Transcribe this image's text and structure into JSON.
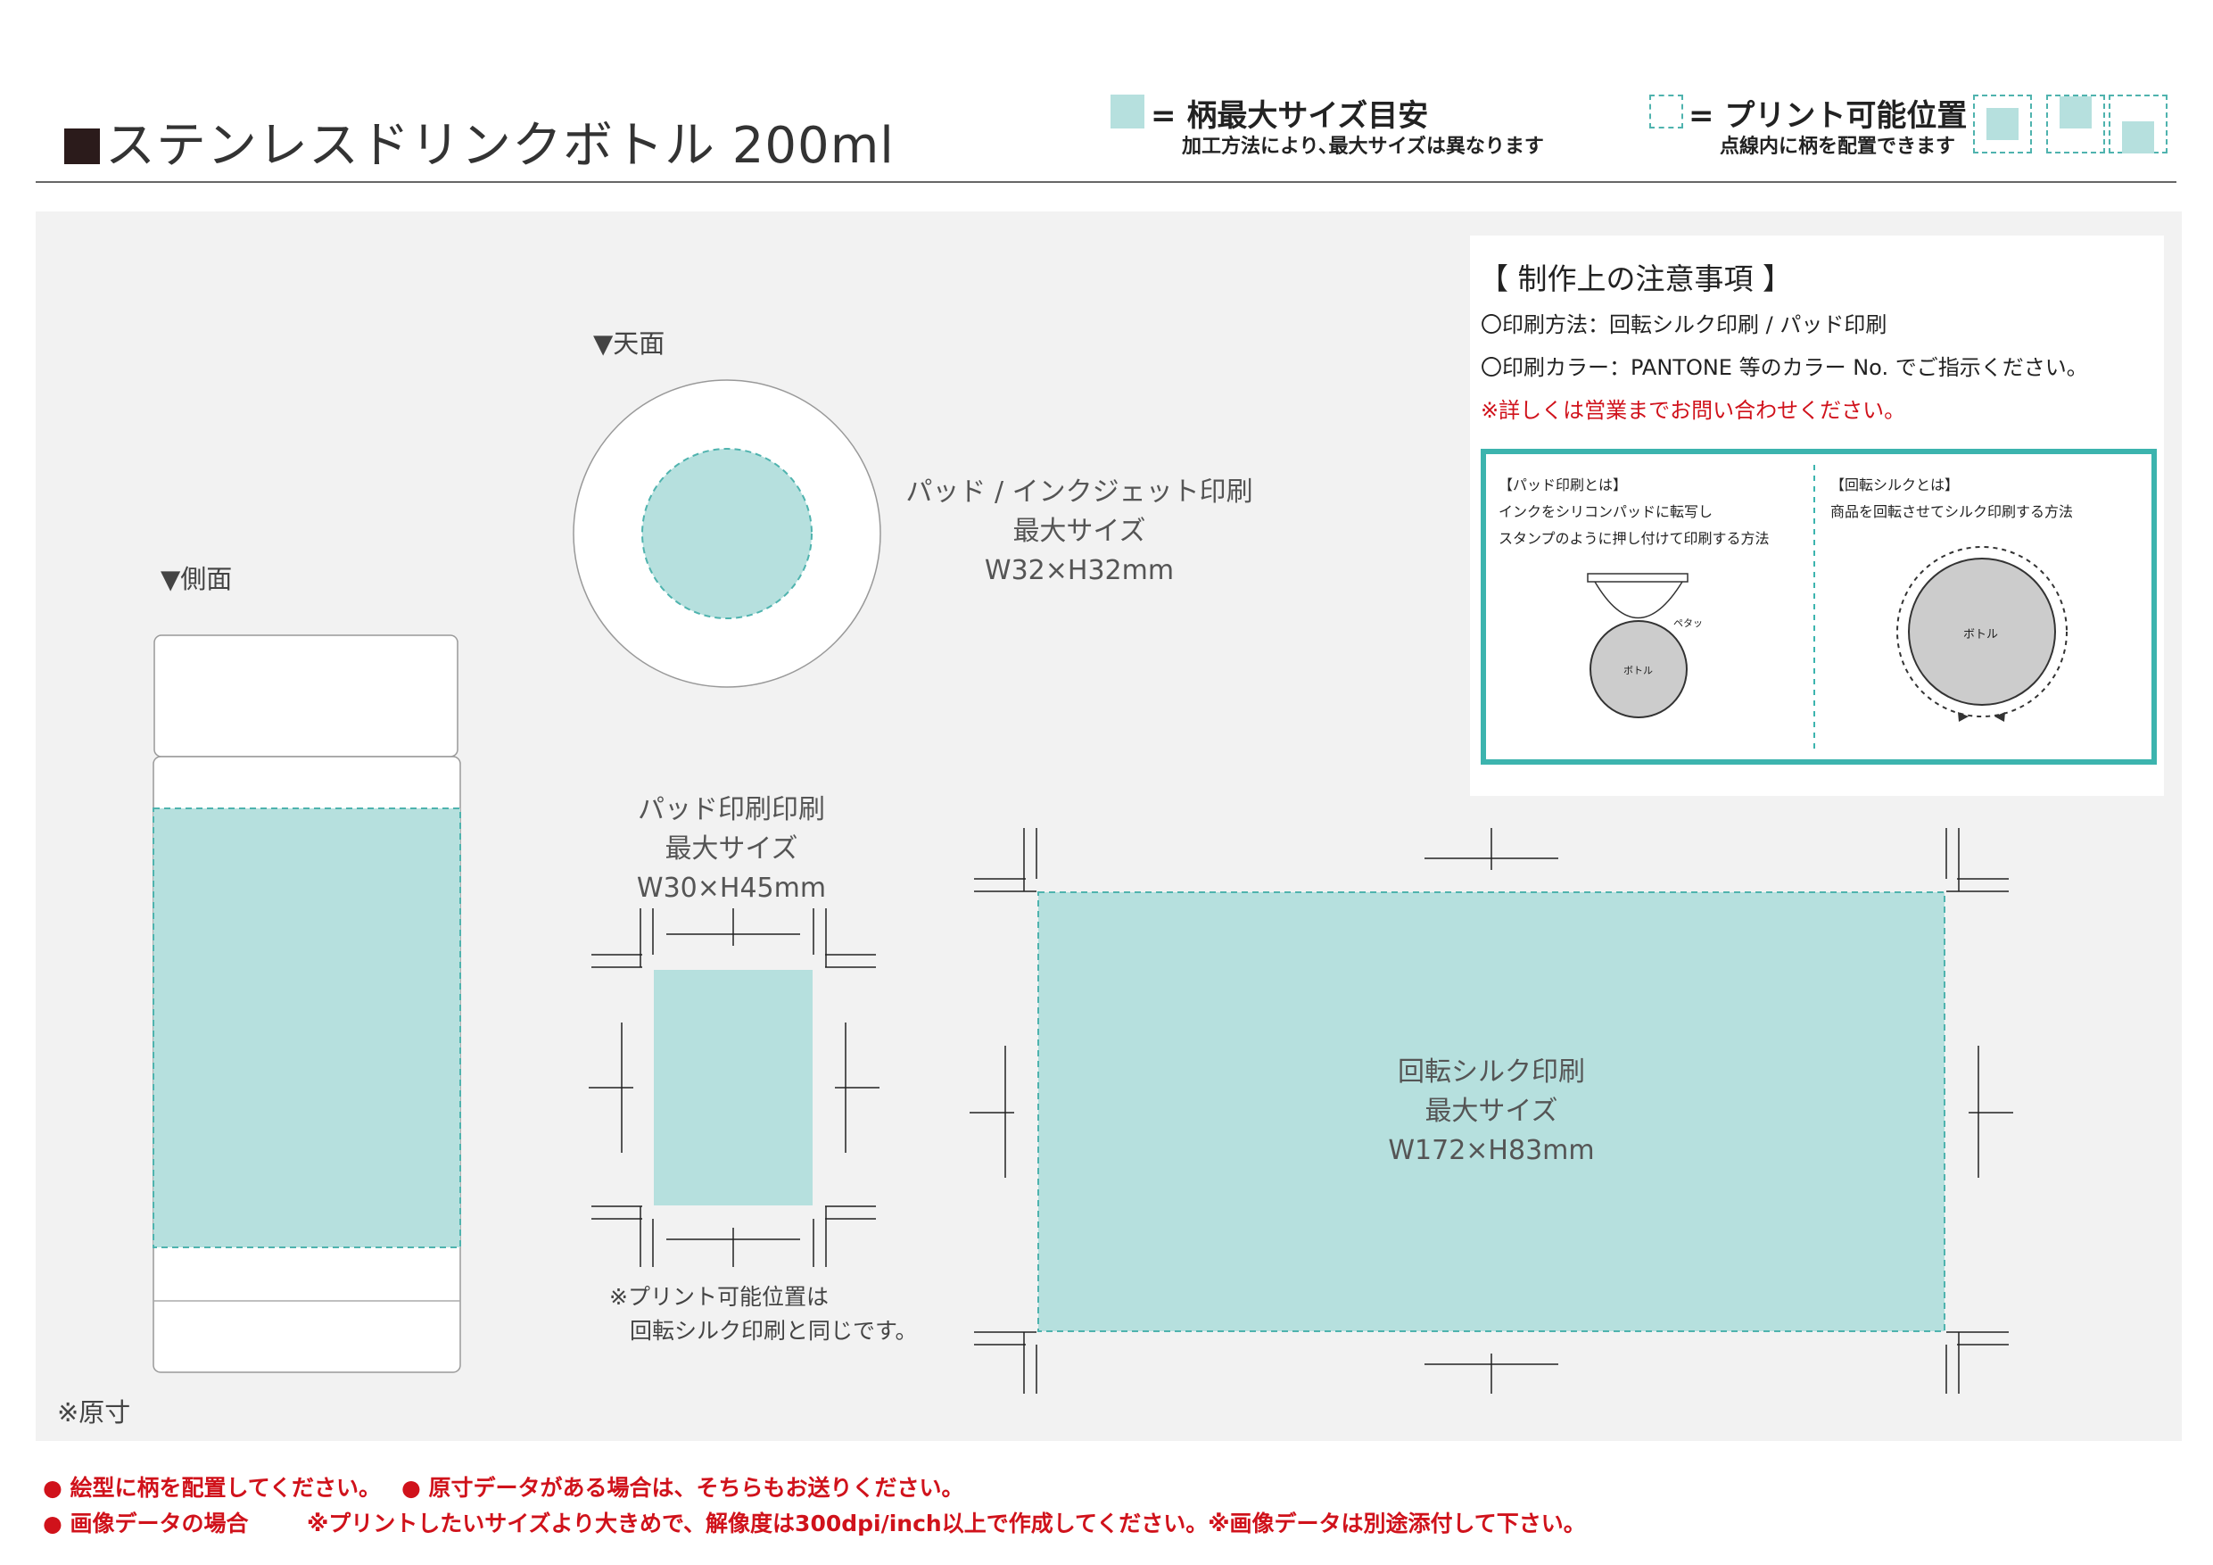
{
  "header": {
    "title": "ステンレスドリンクボトル 200ml"
  },
  "legend": {
    "max_size_label": "= 柄最大サイズ目安",
    "max_size_note": "加工方法により､最大サイズは異なります",
    "print_position_label": "= プリント可能位置",
    "print_position_note": "点線内に柄を配置できます"
  },
  "views": {
    "side_label": "▼側面",
    "top_label": "▼天面",
    "original_size_note": "※原寸"
  },
  "pad_inkjet": {
    "line1": "パッド / インクジェット印刷",
    "line2": "最大サイズ",
    "line3": "W32×H32mm"
  },
  "pad_print": {
    "line1": "パッド印刷印刷",
    "line2": "最大サイズ",
    "line3": "W30×H45mm",
    "note1": "※プリント可能位置は",
    "note2": "回転シルク印刷と同じです。"
  },
  "rotary_silk": {
    "line1": "回転シルク印刷",
    "line2": "最大サイズ",
    "line3": "W172×H83mm"
  },
  "notes": {
    "heading": "【 制作上の注意事項 】",
    "method": "〇印刷方法：回転シルク印刷 / パッド印刷",
    "color": "〇印刷カラー：PANTONE 等のカラー No. でご指示ください。",
    "inquiry": "※詳しくは営業までお問い合わせください。",
    "pad_title": "【パッド印刷とは】",
    "pad_desc1": "インクをシリコンパッドに転写し",
    "pad_desc2": "スタンプのように押し付けて印刷する方法",
    "pad_sound": "ペタッ",
    "pad_bottle": "ボトル",
    "silk_title": "【回転シルクとは】",
    "silk_desc": "商品を回転させてシルク印刷する方法",
    "silk_bottle": "ボトル"
  },
  "footer": {
    "line1a": "● 絵型に柄を配置してください。",
    "line1b": "● 原寸データがある場合は、そちらもお送りください。",
    "line2a": "● 画像データの場合",
    "line2b": "※プリントしたいサイズより大きめで、解像度は300dpi/inch以上で作成してください。※画像データは別途添付して下さい。"
  },
  "colors": {
    "print_area": "#b6e0de",
    "dash": "#4fb3ae",
    "frame_teal": "#3cb4ae",
    "alert_red": "#d0121b"
  }
}
